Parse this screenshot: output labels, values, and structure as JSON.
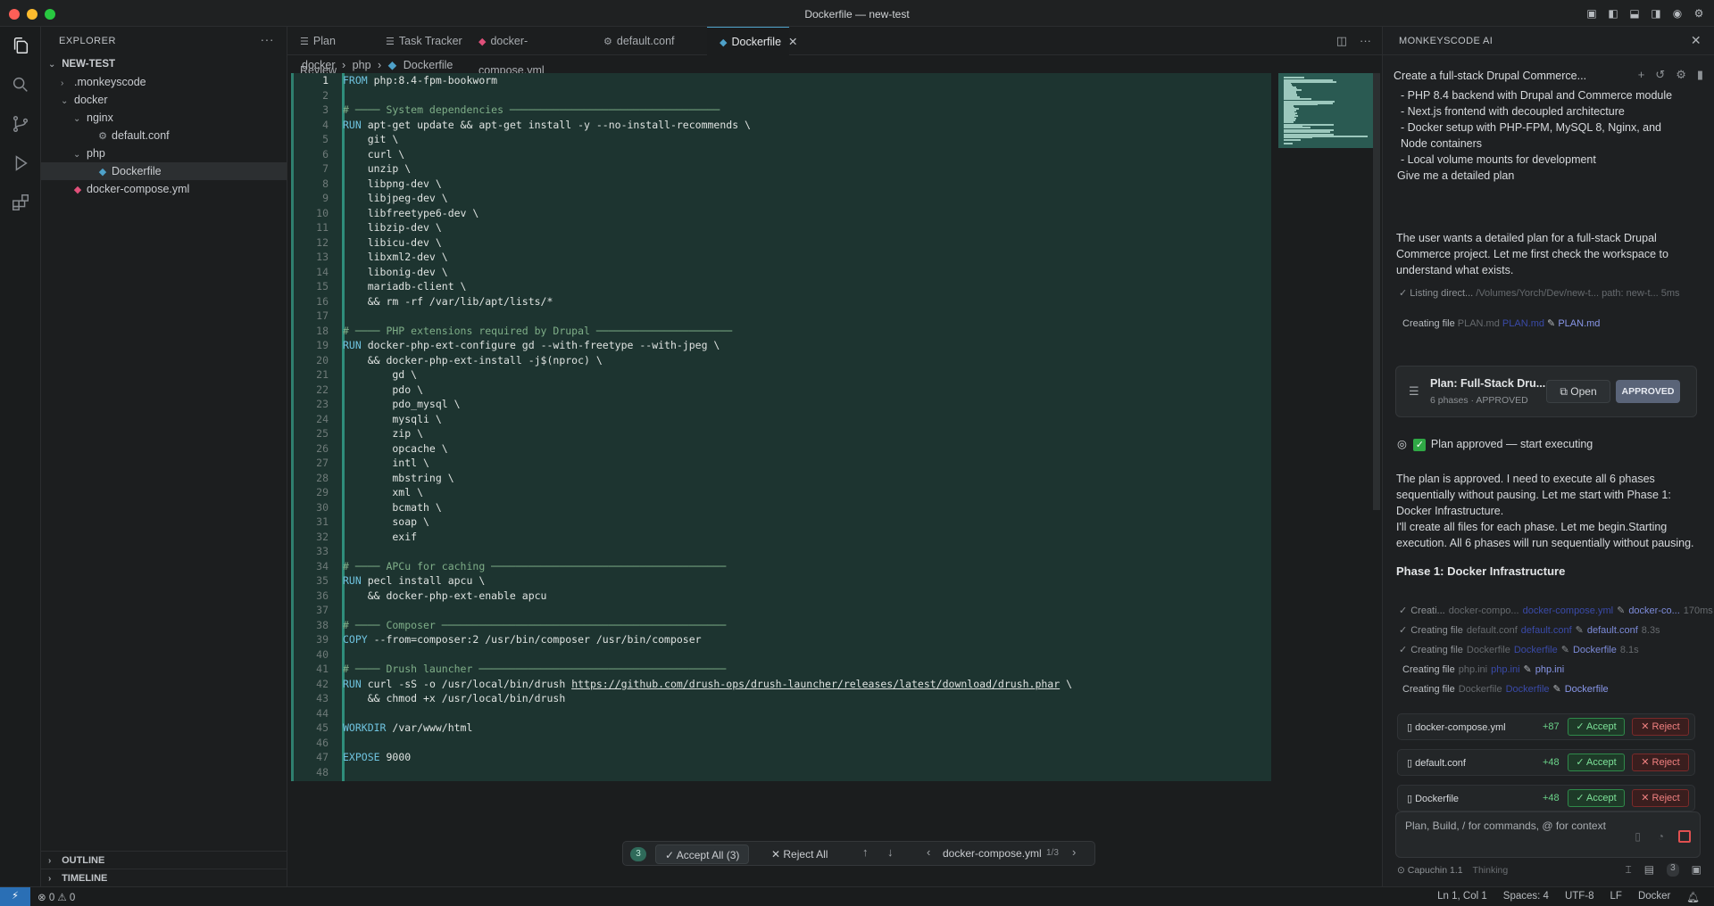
{
  "window": {
    "title": "Dockerfile — new-test"
  },
  "explorer": {
    "header": "EXPLORER",
    "root": "NEW-TEST",
    "tree": [
      {
        "label": ".monkeyscode",
        "depth": 1,
        "chev": "›",
        "icon": ""
      },
      {
        "label": "docker",
        "depth": 1,
        "chev": "⌄",
        "icon": ""
      },
      {
        "label": "nginx",
        "depth": 2,
        "chev": "⌄",
        "icon": ""
      },
      {
        "label": "default.conf",
        "depth": 3,
        "chev": "",
        "icon": "gear-icon"
      },
      {
        "label": "php",
        "depth": 2,
        "chev": "⌄",
        "icon": ""
      },
      {
        "label": "Dockerfile",
        "depth": 3,
        "chev": "",
        "icon": "docker-icon",
        "selected": true
      },
      {
        "label": "docker-compose.yml",
        "depth": 1,
        "chev": "",
        "icon": "docker-compose-icon"
      }
    ],
    "outline": "OUTLINE",
    "timeline": "TIMELINE"
  },
  "tabs": [
    {
      "label": "Plan Review",
      "icon": "list-icon"
    },
    {
      "label": "Task Tracker",
      "icon": "list-icon"
    },
    {
      "label": "docker-compose.yml",
      "icon": "docker-compose-icon"
    },
    {
      "label": "default.conf",
      "icon": "gear-icon"
    },
    {
      "label": "Dockerfile",
      "icon": "docker-icon",
      "active": true
    }
  ],
  "breadcrumb": [
    "docker",
    "php",
    "Dockerfile"
  ],
  "code": [
    [
      [
        "kw",
        "FROM"
      ],
      [
        "t",
        " php:8.4-fpm-bookworm"
      ]
    ],
    [],
    [
      [
        "cm",
        "# ──── System dependencies ──────────────────────────────────"
      ]
    ],
    [
      [
        "kw",
        "RUN"
      ],
      [
        "t",
        " apt-get update && apt-get install -y --no-install-recommends \\"
      ]
    ],
    [
      [
        "t",
        "    git \\"
      ]
    ],
    [
      [
        "t",
        "    curl \\"
      ]
    ],
    [
      [
        "t",
        "    unzip \\"
      ]
    ],
    [
      [
        "t",
        "    libpng-dev \\"
      ]
    ],
    [
      [
        "t",
        "    libjpeg-dev \\"
      ]
    ],
    [
      [
        "t",
        "    libfreetype6-dev \\"
      ]
    ],
    [
      [
        "t",
        "    libzip-dev \\"
      ]
    ],
    [
      [
        "t",
        "    libicu-dev \\"
      ]
    ],
    [
      [
        "t",
        "    libxml2-dev \\"
      ]
    ],
    [
      [
        "t",
        "    libonig-dev \\"
      ]
    ],
    [
      [
        "t",
        "    mariadb-client \\"
      ]
    ],
    [
      [
        "t",
        "    && rm -rf /var/lib/apt/lists/*"
      ]
    ],
    [],
    [
      [
        "cm",
        "# ──── PHP extensions required by Drupal ──────────────────────"
      ]
    ],
    [
      [
        "kw",
        "RUN"
      ],
      [
        "t",
        " docker-php-ext-configure gd --with-freetype --with-jpeg \\"
      ]
    ],
    [
      [
        "t",
        "    && docker-php-ext-install -j$(nproc) \\"
      ]
    ],
    [
      [
        "t",
        "        gd \\"
      ]
    ],
    [
      [
        "t",
        "        pdo \\"
      ]
    ],
    [
      [
        "t",
        "        pdo_mysql \\"
      ]
    ],
    [
      [
        "t",
        "        mysqli \\"
      ]
    ],
    [
      [
        "t",
        "        zip \\"
      ]
    ],
    [
      [
        "t",
        "        opcache \\"
      ]
    ],
    [
      [
        "t",
        "        intl \\"
      ]
    ],
    [
      [
        "t",
        "        mbstring \\"
      ]
    ],
    [
      [
        "t",
        "        xml \\"
      ]
    ],
    [
      [
        "t",
        "        bcmath \\"
      ]
    ],
    [
      [
        "t",
        "        soap \\"
      ]
    ],
    [
      [
        "t",
        "        exif"
      ]
    ],
    [],
    [
      [
        "cm",
        "# ──── APCu for caching ──────────────────────────────────────"
      ]
    ],
    [
      [
        "kw",
        "RUN"
      ],
      [
        "t",
        " pecl install apcu \\"
      ]
    ],
    [
      [
        "t",
        "    && docker-php-ext-enable apcu"
      ]
    ],
    [],
    [
      [
        "cm",
        "# ──── Composer ──────────────────────────────────────────────"
      ]
    ],
    [
      [
        "kw",
        "COPY"
      ],
      [
        "t",
        " --from=composer:2 /usr/bin/composer /usr/bin/composer"
      ]
    ],
    [],
    [
      [
        "cm",
        "# ──── Drush launcher ────────────────────────────────────────"
      ]
    ],
    [
      [
        "kw",
        "RUN"
      ],
      [
        "t",
        " curl -sS -o /usr/local/bin/drush "
      ],
      [
        "u",
        "https://github.com/drush-ops/drush-launcher/releases/latest/download/drush.phar"
      ],
      [
        "t",
        " \\"
      ]
    ],
    [
      [
        "t",
        "    && chmod +x /usr/local/bin/drush"
      ]
    ],
    [],
    [
      [
        "kw",
        "WORKDIR"
      ],
      [
        "t",
        " /var/www/html"
      ]
    ],
    [],
    [
      [
        "kw",
        "EXPOSE"
      ],
      [
        "t",
        " 9000"
      ]
    ],
    []
  ],
  "review_bar": {
    "count": "3",
    "accept_all": "✓ Accept All (3)",
    "reject_all": "✕ Reject All",
    "file": "docker-compose.yml",
    "position": "1/3"
  },
  "ai": {
    "panel_title": "MONKEYSCODE AI",
    "conversation_title": "Create a full-stack Drupal Commerce...",
    "bullets": [
      "- PHP 8.4 backend with Drupal and Commerce module",
      "- Next.js frontend with decoupled architecture",
      "- Docker setup with PHP-FPM, MySQL 8, Nginx, and Node containers",
      "- Local volume mounts for development",
      "Give me a detailed plan"
    ],
    "msg1": "The user wants a detailed plan for a full-stack Drupal Commerce project. Let me first check the workspace to understand what exists.",
    "listing": {
      "label": "Listing direct...",
      "path": "/Volumes/Yorch/Dev/new-t...",
      "extra": "path: new-t...",
      "time": "5ms"
    },
    "creating_plan": {
      "label": "Creating file",
      "name": "PLAN.md",
      "link": "PLAN.md",
      "file": "PLAN.md"
    },
    "plan_card": {
      "title": "Plan: Full-Stack Dru...",
      "sub": "6 phases · APPROVED",
      "open": "Open",
      "approved": "APPROVED"
    },
    "approved_line": "Plan approved — start executing",
    "msg2": "The plan is approved. I need to execute all 6 phases sequentially without pausing. Let me start with Phase 1: Docker Infrastructure.",
    "msg3": "I'll create all files for each phase. Let me begin.Starting execution. All 6 phases will run sequentially without pausing.",
    "phase_heading": "Phase 1: Docker Infrastructure",
    "file_ops": [
      {
        "label": "Creati...",
        "name": "docker-compo...",
        "link": "docker-compose.yml",
        "file": "docker-co...",
        "time": "170ms",
        "dim": true
      },
      {
        "label": "Creating file",
        "name": "default.conf",
        "link": "default.conf",
        "file": "default.conf",
        "time": "8.3s",
        "dim": true
      },
      {
        "label": "Creating file",
        "name": "Dockerfile",
        "link": "Dockerfile",
        "file": "Dockerfile",
        "time": "8.1s",
        "dim": true
      },
      {
        "label": "Creating file",
        "name": "php.ini",
        "link": "php.ini",
        "file": "php.ini",
        "time": "",
        "dim": false
      },
      {
        "label": "Creating file",
        "name": "Dockerfile",
        "link": "Dockerfile",
        "file": "Dockerfile",
        "time": "",
        "dim": false
      }
    ],
    "diffs": [
      {
        "name": "docker-compose.yml",
        "plus": "+87",
        "accept": "✓ Accept",
        "reject": "✕ Reject"
      },
      {
        "name": "default.conf",
        "plus": "+48",
        "accept": "✓ Accept",
        "reject": "✕ Reject"
      },
      {
        "name": "Dockerfile",
        "plus": "+48",
        "accept": "✓ Accept",
        "reject": "✕ Reject"
      }
    ],
    "input_placeholder": "Plan, Build, / for commands, @ for context",
    "model": "Capuchin 1.1",
    "model_state": "Thinking",
    "footer_badge": "3"
  },
  "status": {
    "problems": "⊗ 0 ⚠ 0",
    "position": "Ln 1, Col 1",
    "spaces": "Spaces: 4",
    "encoding": "UTF-8",
    "eol": "LF",
    "language": "Docker"
  }
}
